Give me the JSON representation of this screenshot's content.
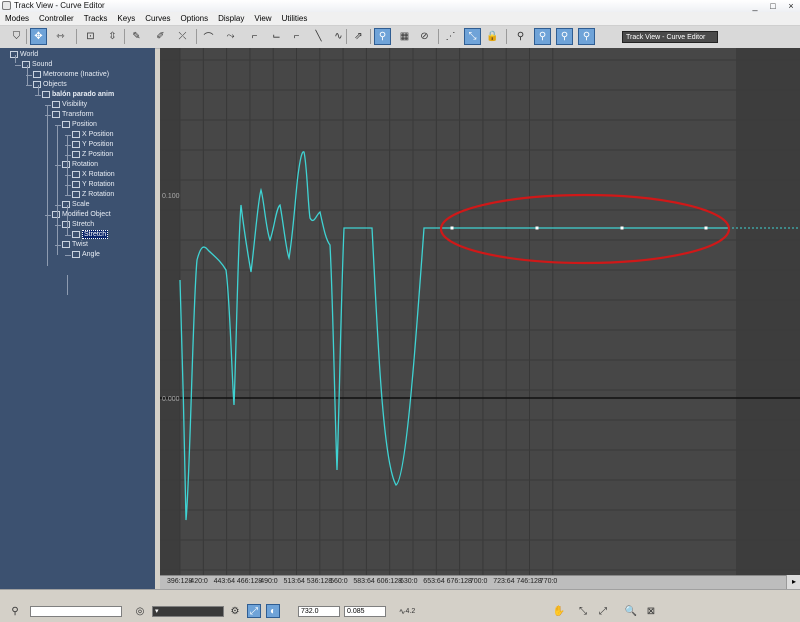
{
  "window": {
    "title": "Track View - Curve Editor",
    "controls": [
      "_",
      "□",
      "×"
    ]
  },
  "menu": [
    "Modes",
    "Controller",
    "Tracks",
    "Keys",
    "Curves",
    "Options",
    "Display",
    "View",
    "Utilities"
  ],
  "toolbar": {
    "buttons": [
      {
        "icon": "filter-icon",
        "glyph": "⛉"
      },
      {
        "icon": "move-keys-icon",
        "glyph": "✥",
        "active": true
      },
      {
        "icon": "slide-keys-icon",
        "glyph": "⇿"
      },
      {
        "icon": "scale-keys-icon",
        "glyph": "⊡"
      },
      {
        "icon": "scale-values-icon",
        "glyph": "⇳"
      },
      {
        "icon": "add-keys-icon",
        "glyph": "✎"
      },
      {
        "icon": "draw-curves-icon",
        "glyph": "✐"
      },
      {
        "icon": "reduce-keys-icon",
        "glyph": "⤫"
      },
      {
        "icon": "tangent-auto-icon",
        "glyph": "⌒"
      },
      {
        "icon": "tangent-custom-icon",
        "glyph": "⤳"
      },
      {
        "icon": "tangent-fast-icon",
        "glyph": "⌐"
      },
      {
        "icon": "tangent-slow-icon",
        "glyph": "⌙"
      },
      {
        "icon": "tangent-step-icon",
        "glyph": "⌐"
      },
      {
        "icon": "tangent-linear-icon",
        "glyph": "╲"
      },
      {
        "icon": "tangent-smooth-icon",
        "glyph": "∿"
      },
      {
        "icon": "parameter-out-of-range-icon",
        "glyph": "⇗"
      },
      {
        "icon": "show-keyable-icon",
        "glyph": "⚲",
        "active": true
      },
      {
        "icon": "show-tangents-icon",
        "glyph": "▦"
      },
      {
        "icon": "lock-selection-icon",
        "glyph": "⊘"
      },
      {
        "icon": "snap-frames-icon",
        "glyph": "⋰"
      },
      {
        "icon": "show-all-tangents-icon",
        "glyph": "⤡",
        "active": true
      },
      {
        "icon": "lock-tangents-icon",
        "glyph": "🔒"
      },
      {
        "icon": "biped-icon-1",
        "glyph": "⚲"
      },
      {
        "icon": "biped-icon-2",
        "glyph": "⚲",
        "active": true
      },
      {
        "icon": "biped-icon-3",
        "glyph": "⚲",
        "active": true
      },
      {
        "icon": "biped-icon-4",
        "glyph": "⚲",
        "active": true
      }
    ],
    "name_field": "Track View - Curve Editor"
  },
  "tree": [
    {
      "label": "World",
      "level": 0
    },
    {
      "label": "Sound",
      "level": 1
    },
    {
      "label": "Metronome (Inactive)",
      "level": 2
    },
    {
      "label": "Objects",
      "level": 2
    },
    {
      "label": "balón parado anim",
      "level": 3,
      "bold": true
    },
    {
      "label": "Visibility",
      "level": 4
    },
    {
      "label": "Transform",
      "level": 4
    },
    {
      "label": "Position",
      "level": 5
    },
    {
      "label": "X Position",
      "level": 6
    },
    {
      "label": "Y Position",
      "level": 6
    },
    {
      "label": "Z Position",
      "level": 6
    },
    {
      "label": "Rotation",
      "level": 5
    },
    {
      "label": "X Rotation",
      "level": 6
    },
    {
      "label": "Y Rotation",
      "level": 6
    },
    {
      "label": "Z Rotation",
      "level": 6
    },
    {
      "label": "Scale",
      "level": 5
    },
    {
      "label": "Modified Object",
      "level": 4
    },
    {
      "label": "Stretch",
      "level": 5
    },
    {
      "label": "Stretch",
      "level": 6,
      "selected": true
    },
    {
      "label": "Twist",
      "level": 5
    },
    {
      "label": "Angle",
      "level": 6
    }
  ],
  "graph": {
    "y_labels": [
      "0.100",
      "0.000"
    ],
    "curve_color": "#3fd3d3",
    "annotation_color": "#d01818"
  },
  "ruler": [
    "396:128",
    "420:0",
    "443:64",
    "466:128",
    "490:0",
    "513:64",
    "536:128",
    "560:0",
    "583:64",
    "606:128",
    "630:0",
    "653:64",
    "676:128",
    "700:0",
    "723:64",
    "746:128",
    "770:0"
  ],
  "status": {
    "frame": "732.0",
    "value": "0.085",
    "zoom": "4.2"
  }
}
